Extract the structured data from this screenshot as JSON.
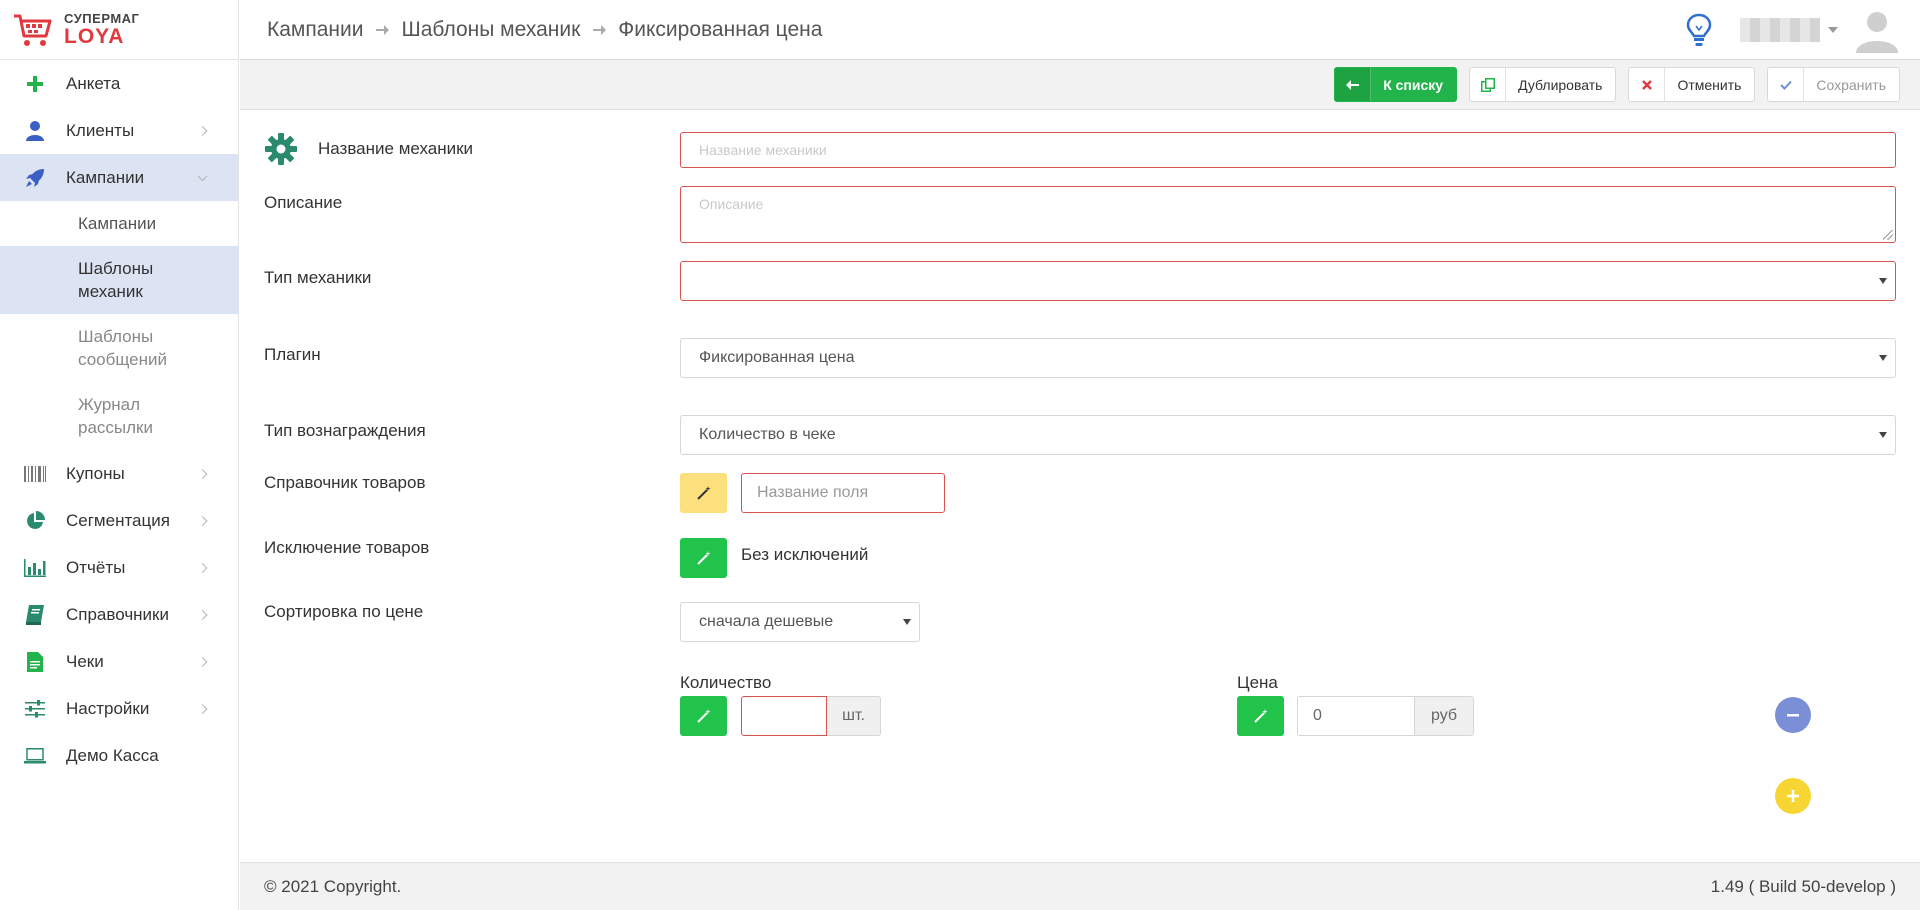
{
  "app": {
    "brand_top": "СУПЕРМАГ",
    "brand_bottom": "LOYA"
  },
  "sidebar": {
    "items": [
      {
        "label": "Анкета",
        "icon": "plus-icon"
      },
      {
        "label": "Клиенты",
        "icon": "user-icon"
      },
      {
        "label": "Кампании",
        "icon": "rocket-icon"
      },
      {
        "label": "Купоны",
        "icon": "barcode-icon"
      },
      {
        "label": "Сегментация",
        "icon": "pie-chart-icon"
      },
      {
        "label": "Отчёты",
        "icon": "bar-chart-icon"
      },
      {
        "label": "Справочники",
        "icon": "book-icon"
      },
      {
        "label": "Чеки",
        "icon": "receipt-icon"
      },
      {
        "label": "Настройки",
        "icon": "sliders-icon"
      },
      {
        "label": "Демо Касса",
        "icon": "laptop-icon"
      }
    ],
    "sub_items": [
      {
        "label": "Кампании"
      },
      {
        "label": "Шаблоны механик"
      },
      {
        "label": "Шаблоны сообщений"
      },
      {
        "label": "Журнал рассылки"
      }
    ]
  },
  "breadcrumb": [
    "Кампании",
    "Шаблоны механик",
    "Фиксированная цена"
  ],
  "toolbar": {
    "back_label": "К списку",
    "duplicate_label": "Дублировать",
    "cancel_label": "Отменить",
    "save_label": "Сохранить"
  },
  "form": {
    "name_label": "Название механики",
    "name_placeholder": "Название механики",
    "description_label": "Описание",
    "description_placeholder": "Описание",
    "type_label": "Тип механики",
    "type_value": "",
    "plugin_label": "Плагин",
    "plugin_value": "Фиксированная цена",
    "reward_label": "Тип вознаграждения",
    "reward_value": "Количество в чеке",
    "catalog_label": "Справочник товаров",
    "catalog_placeholder": "Название поля",
    "exclusion_label": "Исключение товаров",
    "exclusion_value": "Без исключений",
    "sort_label": "Сортировка по цене",
    "sort_value": "сначала дешевые",
    "quantity_label": "Количество",
    "quantity_value": "",
    "quantity_unit": "шт.",
    "price_label": "Цена",
    "price_value": "0",
    "price_unit": "руб"
  },
  "footer": {
    "copyright": "© 2021 Copyright.",
    "version": "1.49 ( Build 50-develop )"
  },
  "colors": {
    "accent_green": "#22b34b",
    "error_red": "#d9534f",
    "brand_red": "#e0393e",
    "active_bg": "#dce3f2",
    "remove_blue": "#7b8fd6",
    "add_yellow": "#f7d532"
  }
}
